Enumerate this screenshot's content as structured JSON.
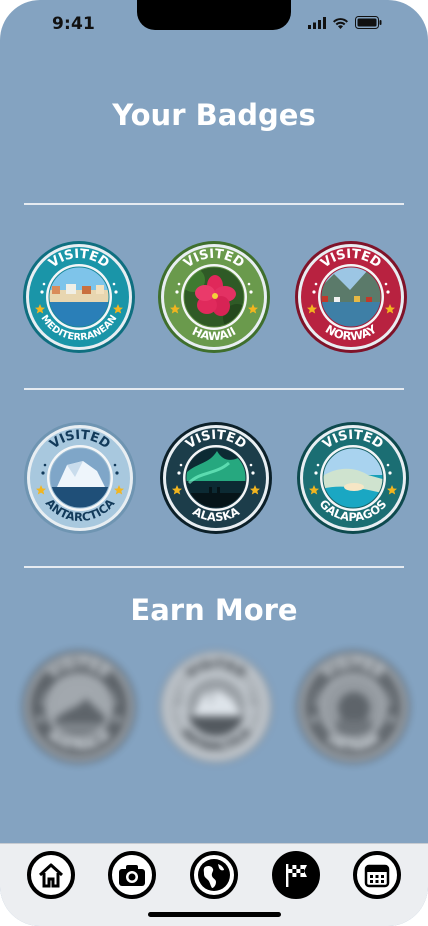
{
  "status_bar": {
    "time": "9:41"
  },
  "headings": {
    "your_badges": "Your Badges",
    "earn_more": "Earn More"
  },
  "earned_badges": [
    {
      "top": "VISITED",
      "place": "MEDITERRANEAN",
      "ring": "#1a95a8",
      "inner": "#19889b",
      "rim": "#0f6f80",
      "scene": "mediterranean"
    },
    {
      "top": "VISITED",
      "place": "HAWAII",
      "ring": "#6a9a4c",
      "inner": "#5b8b40",
      "rim": "#3f6f2d",
      "scene": "hawaii"
    },
    {
      "top": "VISITED",
      "place": "NORWAY",
      "ring": "#b82240",
      "inner": "#a51c37",
      "rim": "#7f1329",
      "scene": "norway"
    },
    {
      "top": "VISITED",
      "place": "ANTARCTICA",
      "ring": "#a8c8de",
      "inner": "#9bbcd3",
      "rim": "#6f95b2",
      "scene": "antarctica",
      "text_color": "#123a5a"
    },
    {
      "top": "VISITED",
      "place": "ALASKA",
      "ring": "#1c3d4a",
      "inner": "#17343f",
      "rim": "#0c2029",
      "scene": "alaska"
    },
    {
      "top": "VISITED",
      "place": "GALAPAGOS",
      "ring": "#1b6e73",
      "inner": "#176166",
      "rim": "#0e4a4e",
      "scene": "galapagos"
    }
  ],
  "locked_badges": [
    {
      "top": "VISITED",
      "place": "AUSTRALIA",
      "ring": "#555555",
      "inner": "#4a4a4a",
      "rim": "#333333",
      "scene": "australia"
    },
    {
      "top": "VISITED",
      "place": "ANTARCTICA",
      "ring": "#bdbdbd",
      "inner": "#b0b0b0",
      "rim": "#8c8c8c",
      "scene": "antarctica",
      "text_color": "#333333"
    },
    {
      "top": "VISITED",
      "place": "VIETNAM",
      "ring": "#5c5c5c",
      "inner": "#505050",
      "rim": "#393939",
      "scene": "vietnam"
    }
  ],
  "tab_bar": {
    "tabs": [
      {
        "name": "home",
        "icon": "home-icon",
        "active": false
      },
      {
        "name": "camera",
        "icon": "camera-icon",
        "active": false
      },
      {
        "name": "globe",
        "icon": "globe-icon",
        "active": false
      },
      {
        "name": "badges",
        "icon": "checkered-flag-icon",
        "active": true
      },
      {
        "name": "calendar",
        "icon": "calendar-icon",
        "active": false
      }
    ]
  }
}
